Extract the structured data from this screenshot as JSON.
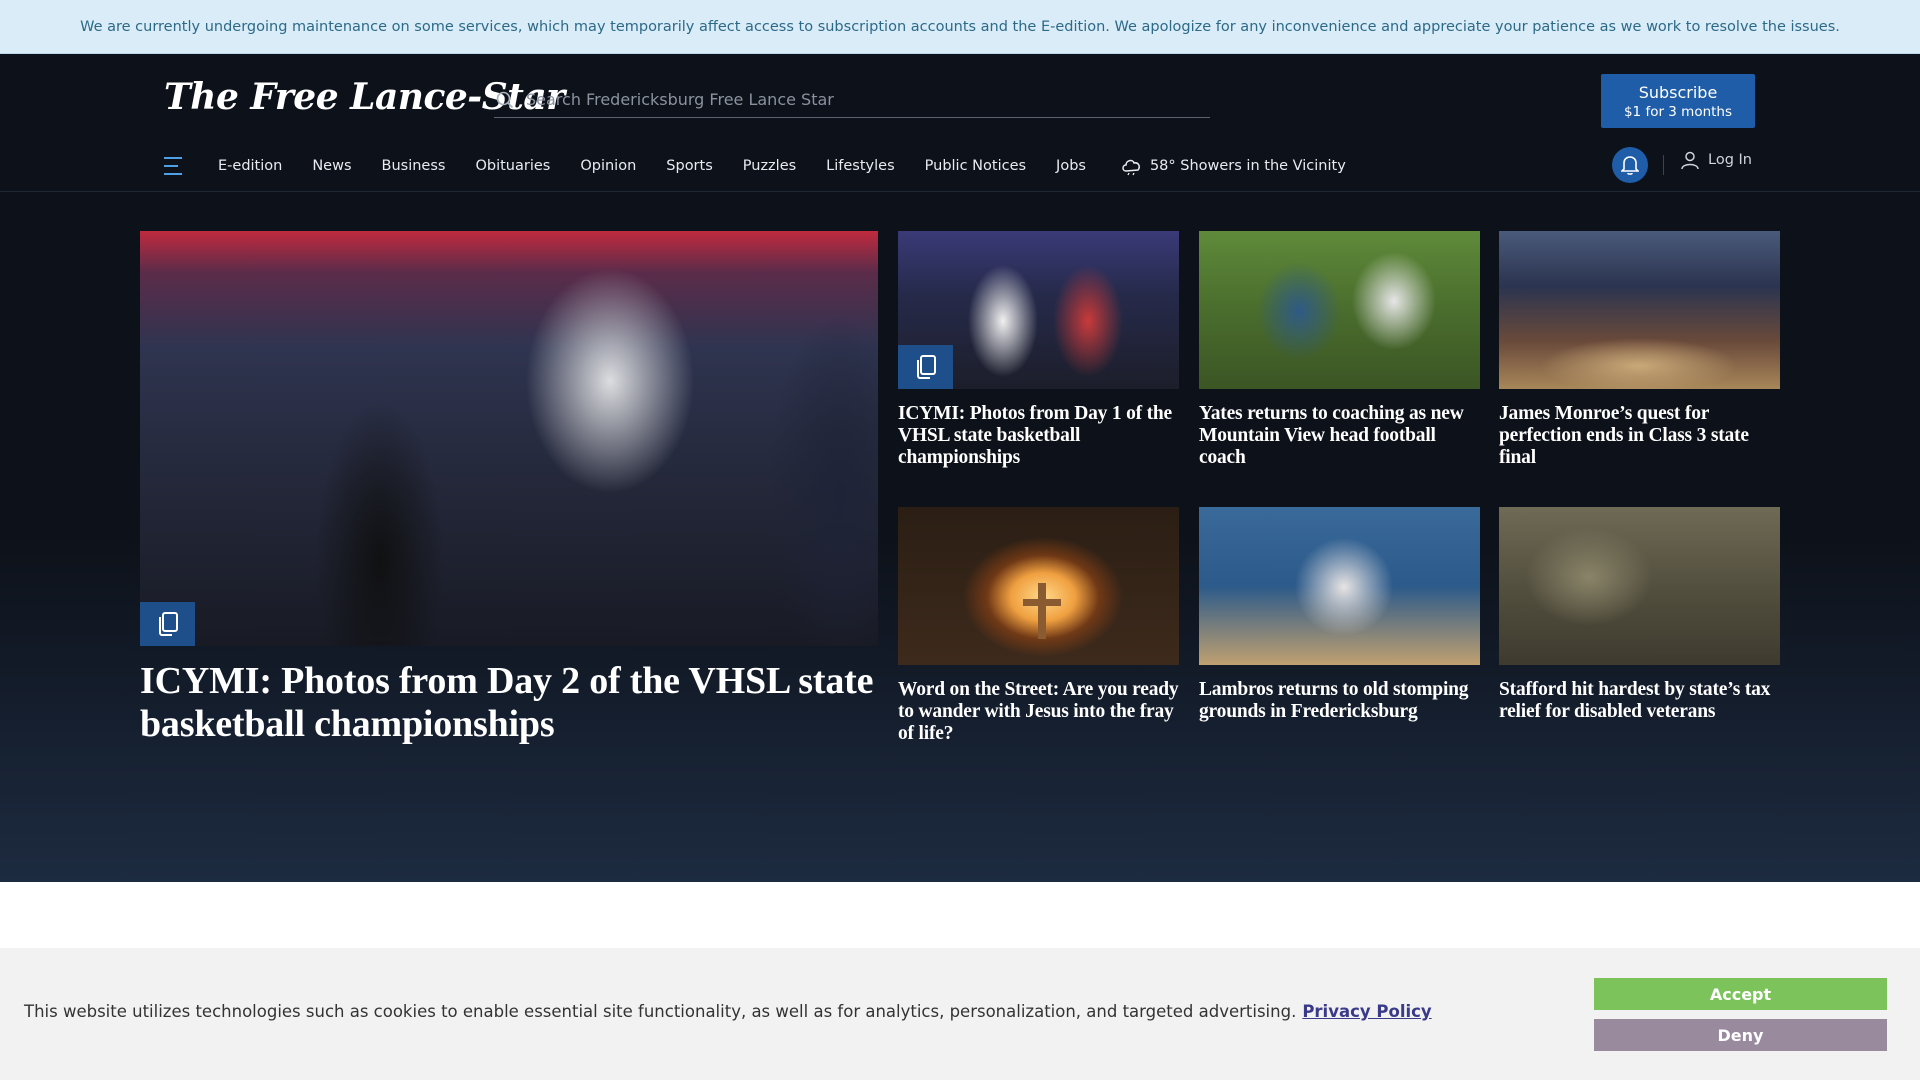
{
  "alert_banner": {
    "text": "We are currently undergoing maintenance on some services, which may temporarily affect access to subscription accounts and the E-edition. We apologize for any inconvenience and appreciate your patience as we work to resolve the issues."
  },
  "header": {
    "logo_text": "The Free Lance-Star",
    "search_placeholder": "Search Fredericksburg Free Lance Star",
    "subscribe_line1": "Subscribe",
    "subscribe_line2": "$1 for 3 months",
    "login_label": "Log In",
    "accent_color": "#1f5da8"
  },
  "nav": {
    "items": [
      "E-edition",
      "News",
      "Business",
      "Obituaries",
      "Opinion",
      "Sports",
      "Puzzles",
      "Lifestyles",
      "Public Notices",
      "Jobs"
    ],
    "weather": "58° Showers in the Vicinity",
    "weather_icon": "cloud-rain-icon"
  },
  "stories": {
    "main": {
      "title": "ICYMI: Photos from Day 2 of the VHSL state basketball championships",
      "image_alt": "basketball player celebrating"
    },
    "grid": [
      {
        "title": "ICYMI: Photos from Day 1 of the VHSL state basketball championships",
        "gallery": true
      },
      {
        "title": "Yates returns to coaching as new Mountain View head football coach",
        "gallery": false
      },
      {
        "title": "James Monroe’s quest for perfection ends in Class 3 state final",
        "gallery": false
      },
      {
        "title": "Word on the Street: Are you ready to wander with Jesus into the fray of life?",
        "gallery": false
      },
      {
        "title": "Lambros returns to old stomping grounds in Fredericksburg",
        "gallery": false
      },
      {
        "title": "Stafford hit hardest by state’s tax relief for disabled veterans",
        "gallery": false
      }
    ]
  },
  "cookie_banner": {
    "text": "This website utilizes technologies such as cookies to enable essential site functionality, as well as for analytics, personalization, and targeted advertising.",
    "policy_link": "Privacy Policy",
    "accept_label": "Accept",
    "deny_label": "Deny",
    "accept_color": "#7cc35b",
    "deny_color": "#9a8a9e"
  }
}
